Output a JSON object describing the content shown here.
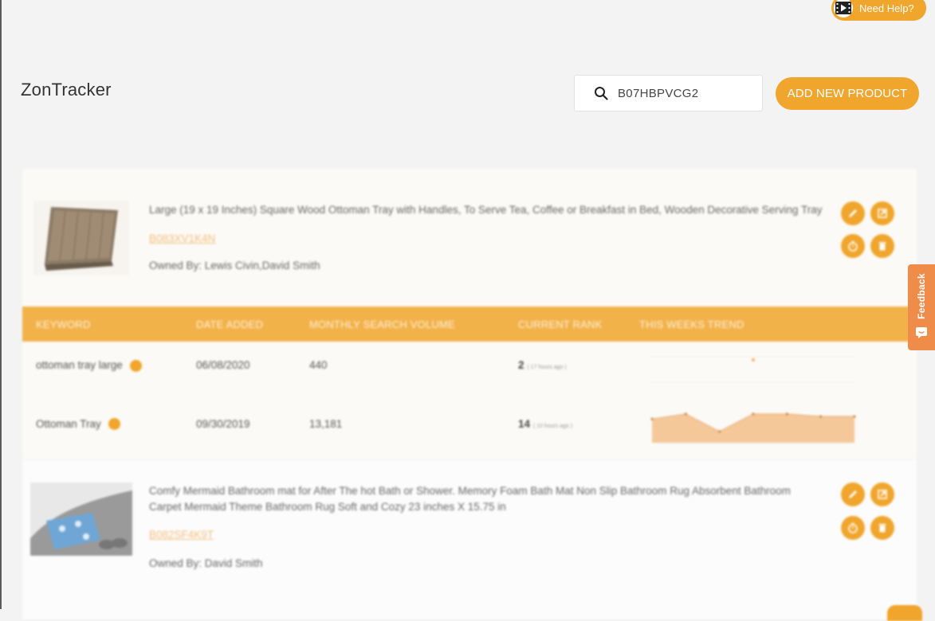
{
  "help": {
    "label": "Need Help?",
    "icon": "video-play-icon"
  },
  "header": {
    "app_title": "ZonTracker"
  },
  "search": {
    "value": "B07HBPVCG2",
    "placeholder": "",
    "icon": "search-icon"
  },
  "toolbar": {
    "add_product_label": "ADD NEW PRODUCT"
  },
  "feedback": {
    "label": "Feedback"
  },
  "colors": {
    "accent": "#f0a52c",
    "table_header": "#f2b24a",
    "feedback": "#f08c49",
    "background": "#f3f3f3"
  },
  "products": [
    {
      "title": "Large (19 x 19 Inches) Square Wood Ottoman Tray with Handles, To Serve Tea, Coffee or Breakfast in Bed, Wooden Decorative Serving Tray",
      "asin": "B083XV1K4N",
      "owners": "Owned By: Lewis Civin,David Smith",
      "actions": [
        "edit-icon",
        "open-external-icon",
        "timer-icon",
        "delete-icon"
      ],
      "table": {
        "columns": [
          "KEYWORD",
          "DATE ADDED",
          "MONTHLY SEARCH VOLUME",
          "CURRENT RANK",
          "THIS WEEKS TREND"
        ],
        "rows": [
          {
            "keyword": "ottoman tray large",
            "date_added": "06/08/2020",
            "volume": "440",
            "rank": "2",
            "rank_ago": "( 17 hours ago )",
            "trend": [
              null,
              null,
              null,
              null,
              null,
              null,
              2
            ]
          },
          {
            "keyword": "Ottoman Tray",
            "date_added": "09/30/2019",
            "volume": "13,181",
            "rank": "14",
            "rank_ago": "( 10 hours ago )",
            "trend": [
              18,
              16,
              23,
              16,
              16,
              17,
              17
            ]
          }
        ]
      }
    },
    {
      "title": "Comfy Mermaid Bathroom mat for After The hot Bath or Shower. Memory Foam Bath Mat Non Slip Bathroom Rug Absorbent Bathroom Carpet Mermaid Theme Bathroom Rug Soft and Cozy 23 inches X 15.75 in",
      "asin": "B082SF4K9T",
      "owners": "Owned By: David Smith",
      "actions": [
        "edit-icon",
        "open-external-icon",
        "timer-icon",
        "delete-icon"
      ]
    }
  ]
}
